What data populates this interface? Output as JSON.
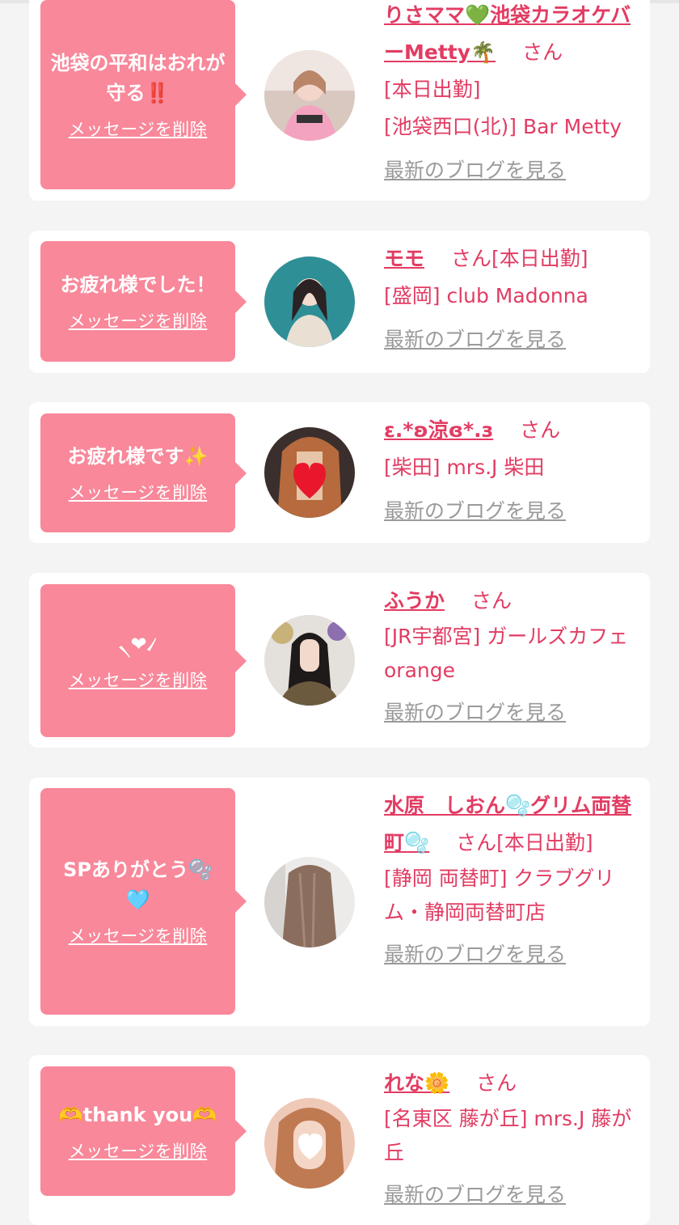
{
  "cards": [
    {
      "message": "池袋の平和はおれが守る‼️",
      "delete_label": "メッセージを削除",
      "name": "りさママ💚池袋カラオケバーMetty🌴",
      "honorific": "さん",
      "status": "[本日出勤]",
      "store": "[池袋西口(北)] Bar Metty",
      "blog_label": "最新のブログを見る"
    },
    {
      "message": "お疲れ様でした！",
      "delete_label": "メッセージを削除",
      "name": "モモ",
      "honorific": "さん",
      "status": "[本日出勤]",
      "store": "[盛岡] club Madonna",
      "blog_label": "最新のブログを見る"
    },
    {
      "message": "お疲れ様です✨",
      "delete_label": "メッセージを削除",
      "name": "ε.*ʚ涼ɞ*.з",
      "honorific": "さん",
      "status": "",
      "store": "[柴田] mrs.J 柴田",
      "blog_label": "最新のブログを見る"
    },
    {
      "message": "৲❤︎৴",
      "delete_label": "メッセージを削除",
      "name": "ふうか",
      "honorific": "さん",
      "status": "",
      "store": "[JR宇都宮] ガールズカフェ orange",
      "blog_label": "最新のブログを見る"
    },
    {
      "message": "SPありがとう🫧🩵",
      "delete_label": "メッセージを削除",
      "name": "水原　しおん🫧グリム両替町🫧",
      "honorific": "さん",
      "status": "[本日出勤]",
      "store": "[静岡 両替町] クラブグリム・静岡両替町店",
      "blog_label": "最新のブログを見る"
    },
    {
      "message": "🫶thank you🫶",
      "delete_label": "メッセージを削除",
      "name": "れな🌼",
      "honorific": "さん",
      "status": "",
      "store": "[名東区 藤が丘] mrs.J 藤が丘",
      "blog_label": "最新のブログを見る"
    }
  ],
  "colors": {
    "accent": "#e23c63",
    "bubble": "#f8889a",
    "muted": "#9a9a9a",
    "background": "#f4f4f4"
  }
}
